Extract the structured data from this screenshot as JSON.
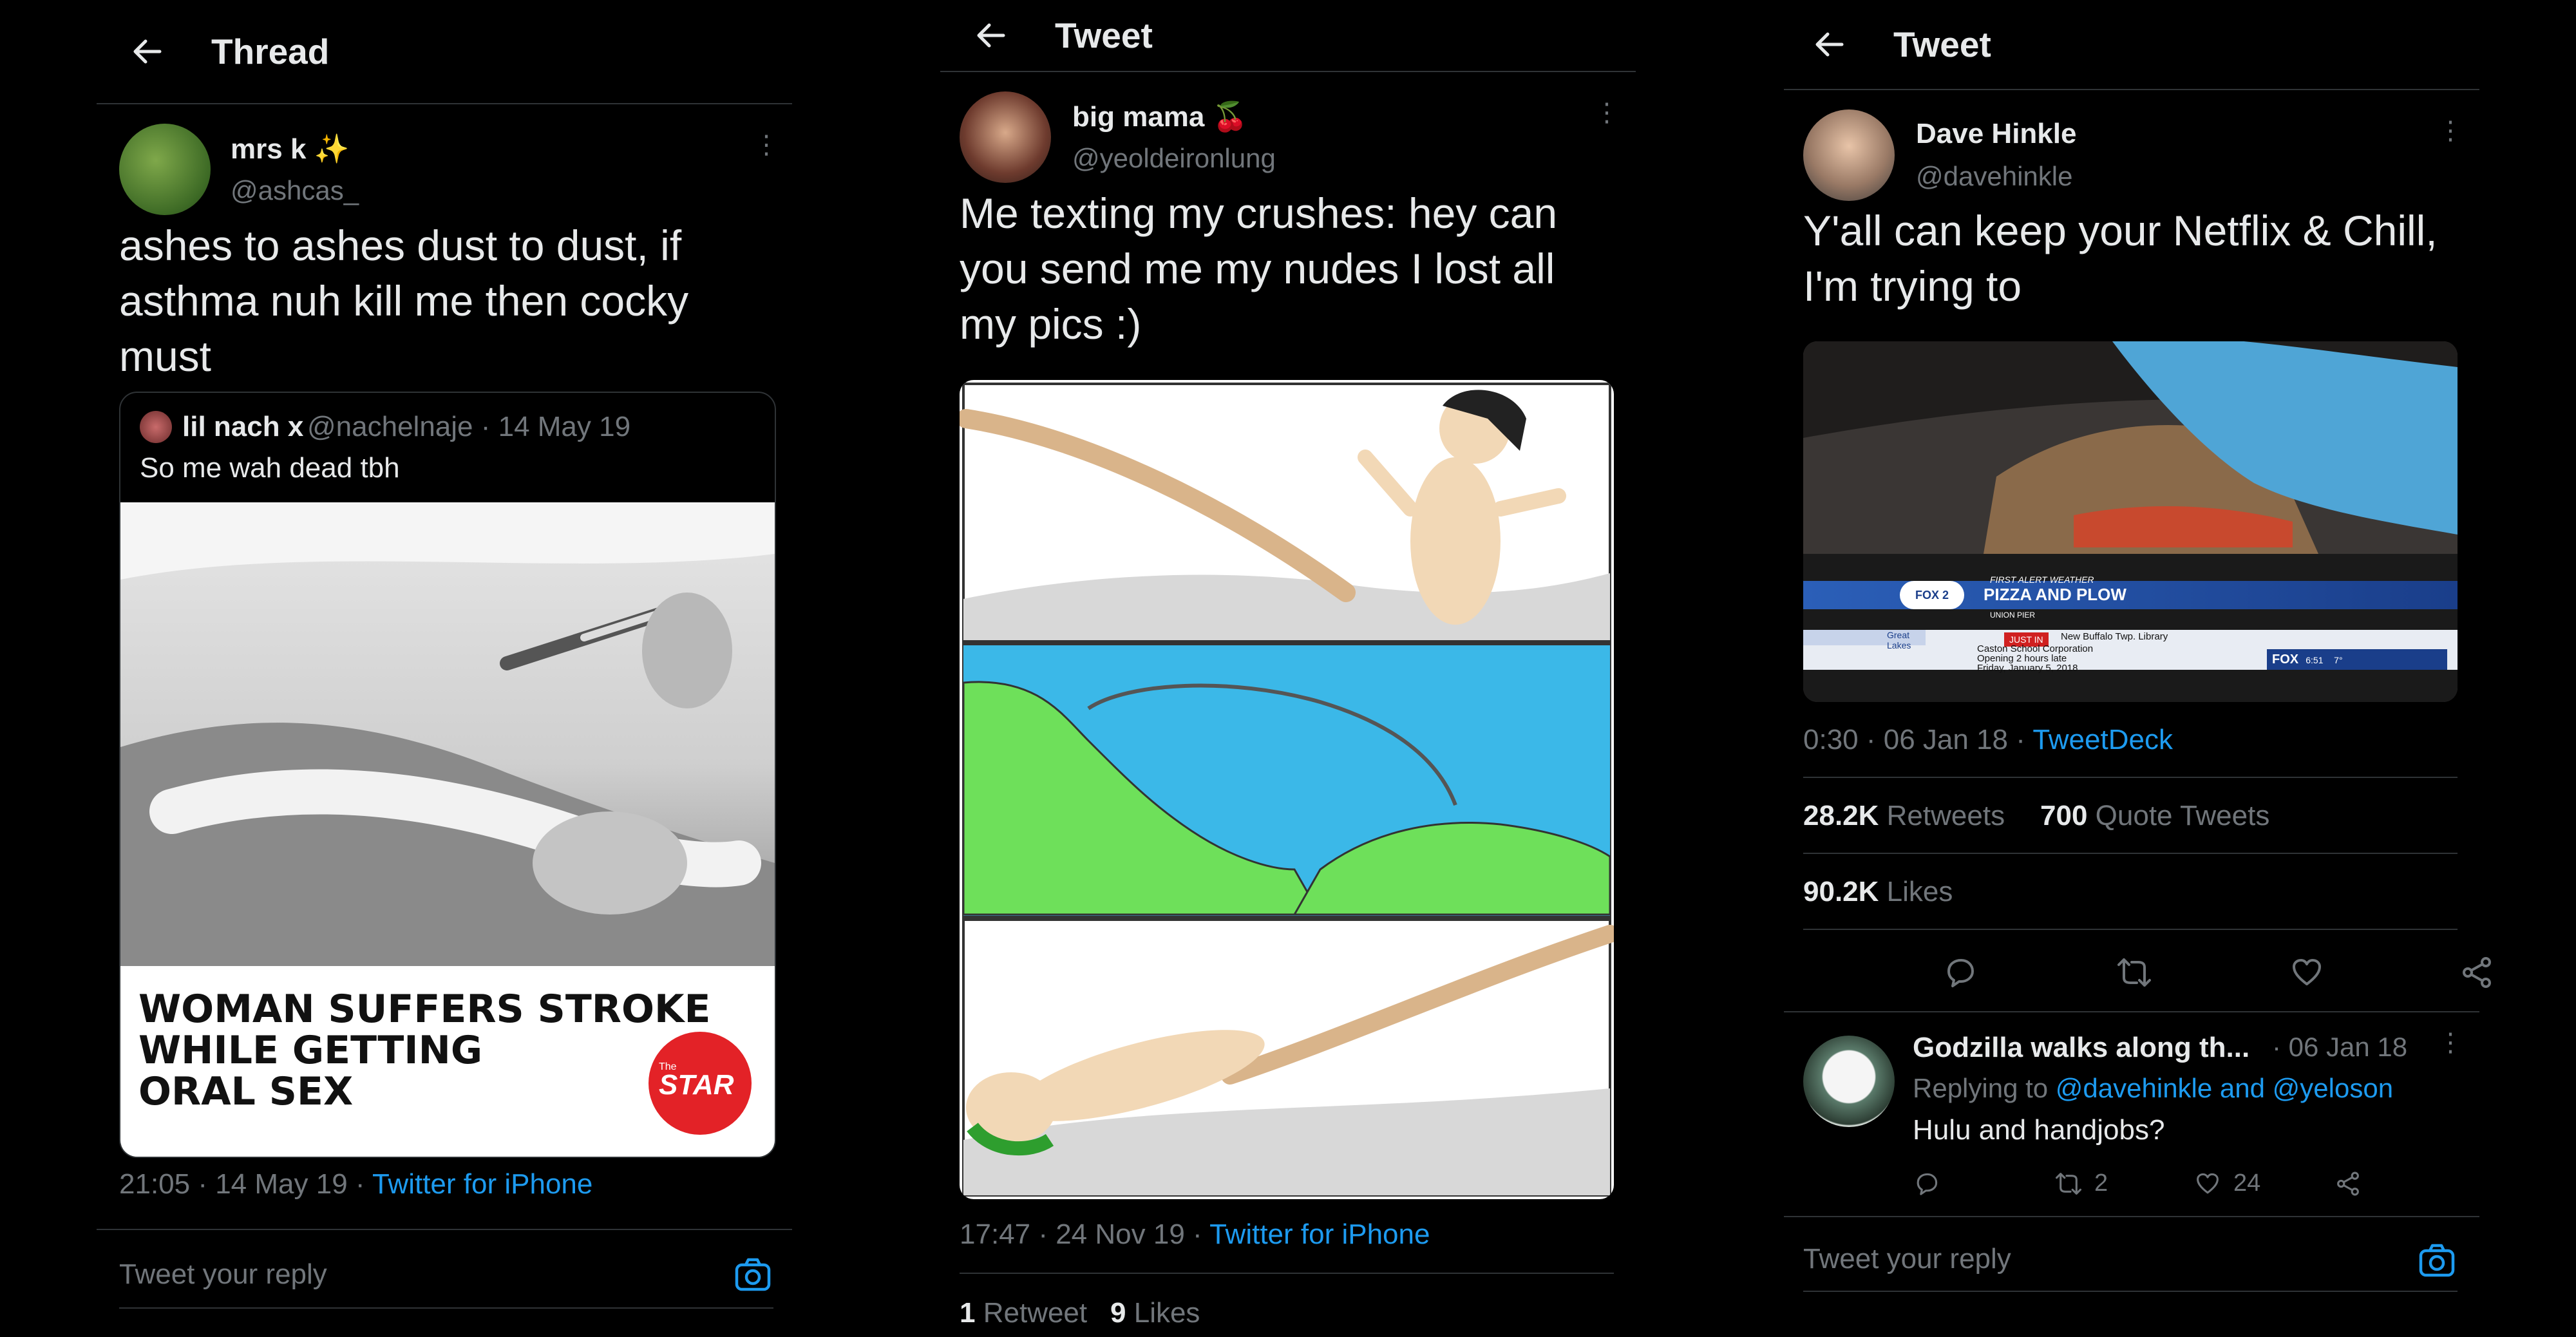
{
  "panels": [
    {
      "header_title": "Thread",
      "author": {
        "name": "mrs k",
        "name_emoji": "✨",
        "handle": "@ashcas_"
      },
      "text": "ashes to ashes dust to dust, if asthma nuh kill me then cocky must",
      "quote": {
        "name": "lil nach x",
        "handle_date": "@nachelnaje · 14 May 19",
        "text": "So me wah dead tbh",
        "image_headline": [
          "WOMAN SUFFERS STROKE",
          "WHILE GETTING",
          "ORAL SEX"
        ],
        "logo_small": "The",
        "logo": "STAR"
      },
      "time": "21:05 · 14 May 19 · ",
      "source": "Twitter for iPhone",
      "reply_placeholder": "Tweet your reply"
    },
    {
      "header_title": "Tweet",
      "author": {
        "name": "big mama",
        "name_emoji": "🍒",
        "handle": "@yeoldeironlung"
      },
      "text": "Me texting my crushes: hey can you send me my nudes I lost all my pics :)",
      "time": "17:47 · 24 Nov 19 · ",
      "source": "Twitter for iPhone",
      "stats": {
        "retweets_count": "1",
        "retweets_label": "Retweet",
        "likes_count": "9",
        "likes_label": "Likes"
      }
    },
    {
      "header_title": "Tweet",
      "author": {
        "name": "Dave Hinkle",
        "handle": "@davehinkle"
      },
      "text": "Y'all can keep your Netflix & Chill, I'm trying to",
      "video_overlay": {
        "top_line": "FIRST ALERT WEATHER",
        "headline": "PIZZA AND PLOW",
        "sub": "UNION PIER",
        "channel": "FOX",
        "channel_num": "2",
        "just_in": "JUST IN",
        "ticker": [
          "New Buffalo Twp. Library",
          "Caston School Corporation",
          "Opening 2 hours late",
          "Friday, January 5, 2018"
        ],
        "sponsor": "Great Lakes",
        "clock": "6:51",
        "temp": "7°"
      },
      "time": "0:30 · 06 Jan 18 · ",
      "source": "TweetDeck",
      "stats": {
        "retweets_count": "28.2K",
        "retweets_label": "Retweets",
        "quotes_count": "700",
        "quotes_label": "Quote Tweets",
        "likes_count": "90.2K",
        "likes_label": "Likes"
      },
      "reply_tweet": {
        "name": "Godzilla walks along th...",
        "date": "· 06 Jan 18",
        "replying_prefix": "Replying to ",
        "replying_to": "@davehinkle and @yeloson",
        "text": "Hulu and handjobs?",
        "retweets": "2",
        "likes": "24"
      },
      "reply_placeholder": "Tweet your reply"
    }
  ],
  "colors": {
    "background": "#000000",
    "text": "#e7e9ea",
    "muted": "#71767b",
    "link": "#1d9bf0",
    "border": "#2f3336"
  },
  "icons": [
    "back-arrow-icon",
    "more-icon",
    "camera-icon",
    "reply-icon",
    "retweet-icon",
    "like-icon",
    "share-icon"
  ]
}
